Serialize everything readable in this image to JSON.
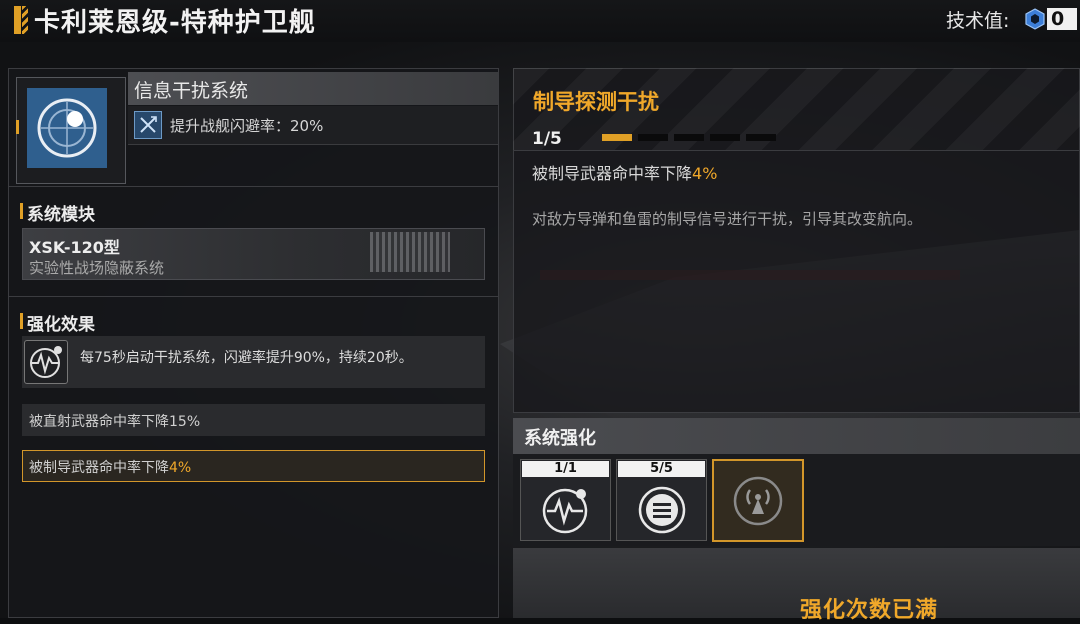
{
  "header": {
    "title": "卡利莱恩级-特种护卫舰",
    "tech_label": "技术值:",
    "tech_value": "0"
  },
  "system": {
    "name": "信息干扰系统",
    "bonus": "提升战舰闪避率：20%"
  },
  "module_section": {
    "title": "系统模块",
    "model": "XSK-120型",
    "description": "实验性战场隐蔽系统"
  },
  "effects_section": {
    "title": "强化效果",
    "main_effect": "每75秒启动干扰系统，闪避率提升90%，持续20秒。",
    "rows": [
      {
        "text": "被直射武器命中率下降15%",
        "value": ""
      },
      {
        "text": "被制导武器命中率下降",
        "value": "4%"
      }
    ]
  },
  "detail": {
    "title": "制导探测干扰",
    "level": "1/5",
    "level_fill": 0.2,
    "effect_text": "被制导武器命中率下降",
    "effect_value": "4%",
    "description": "对敌方导弹和鱼雷的制导信号进行干扰，引导其改变航向。"
  },
  "enhance": {
    "title": "系统强化",
    "slots": [
      {
        "count": "1/1",
        "icon": "signal-wave-icon"
      },
      {
        "count": "5/5",
        "icon": "menu-lines-icon"
      },
      {
        "count": "",
        "icon": "radio-tower-icon"
      }
    ],
    "full_text": "强化次数已满"
  },
  "colors": {
    "accent": "#f0a82a",
    "module_icon_bg": "#2f5f8e"
  }
}
